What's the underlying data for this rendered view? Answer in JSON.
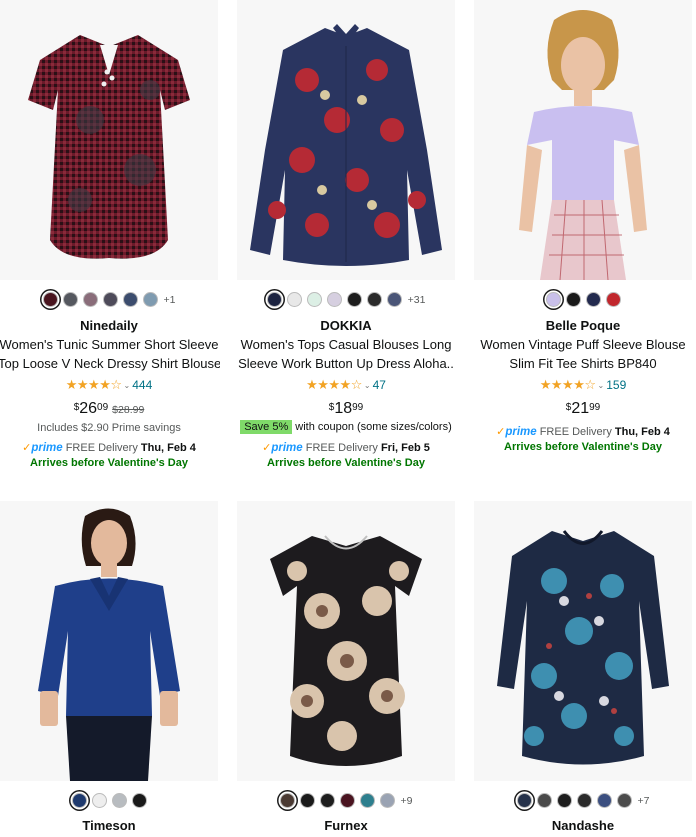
{
  "products": [
    {
      "brand": "Ninedaily",
      "title1": "Women's Tunic Summer Short Sleeve",
      "title2": "Top Loose V Neck Dressy Shirt Blouse",
      "swatches": [
        "#4a1620",
        "#55585f",
        "#8a6d7a",
        "#4e4b5a",
        "#3c4d6e",
        "#7f9bb0"
      ],
      "more": "+1",
      "rating_count": "444",
      "price_cur": "$",
      "price_whole": "26",
      "price_frac": "09",
      "was_price": "$28.99",
      "extra": "Includes $2.90 Prime savings",
      "prime": "prime",
      "delivery_label": "FREE Delivery",
      "delivery_date": "Thu, Feb 4",
      "arrives": "Arrives before Valentine's Day"
    },
    {
      "brand": "DOKKIA",
      "title1": "Women's Tops Casual Blouses Long",
      "title2": "Sleeve Work Button Up Dress Aloha..",
      "swatches": [
        "#1c2340",
        "#e8e8e8",
        "#dcefe5",
        "#d6cfe0",
        "#1e1e1e",
        "#2b2b2b",
        "#4a5577"
      ],
      "more": "+31",
      "rating_count": "47",
      "price_cur": "$",
      "price_whole": "18",
      "price_frac": "99",
      "save_badge": "Save 5%",
      "coupon": "with coupon (some sizes/colors)",
      "prime": "prime",
      "delivery_label": "FREE Delivery",
      "delivery_date": "Fri, Feb 5",
      "arrives": "Arrives before Valentine's Day"
    },
    {
      "brand": "Belle Poque",
      "title1": "Women Vintage Puff Sleeve Blouse",
      "title2": "Slim Fit Tee Shirts BP840",
      "swatches": [
        "#c9c0ea",
        "#1a1a1a",
        "#232a4e",
        "#c1272d"
      ],
      "rating_count": "159",
      "price_cur": "$",
      "price_whole": "21",
      "price_frac": "99",
      "prime": "prime",
      "delivery_label": "FREE Delivery",
      "delivery_date": "Thu, Feb 4",
      "arrives": "Arrives before Valentine's Day"
    },
    {
      "brand": "Timeson",
      "swatches": [
        "#1f3a6e",
        "#eeeeee",
        "#b8bcc0",
        "#1a1a1a"
      ]
    },
    {
      "brand": "Furnex",
      "swatches": [
        "#4a3a33",
        "#1a1a1a",
        "#1e1e1e",
        "#4a1420",
        "#2e7f8e",
        "#9aa3b3"
      ],
      "more": "+9"
    },
    {
      "brand": "Nandashe",
      "swatches": [
        "#26324a",
        "#4a4a4a",
        "#1e1e1e",
        "#2b2b2b",
        "#3c4f80",
        "#4c4c4c"
      ],
      "more": "+7"
    }
  ],
  "stars_glyph": "★★★★☆",
  "chevron": "⌄",
  "check": "✓"
}
